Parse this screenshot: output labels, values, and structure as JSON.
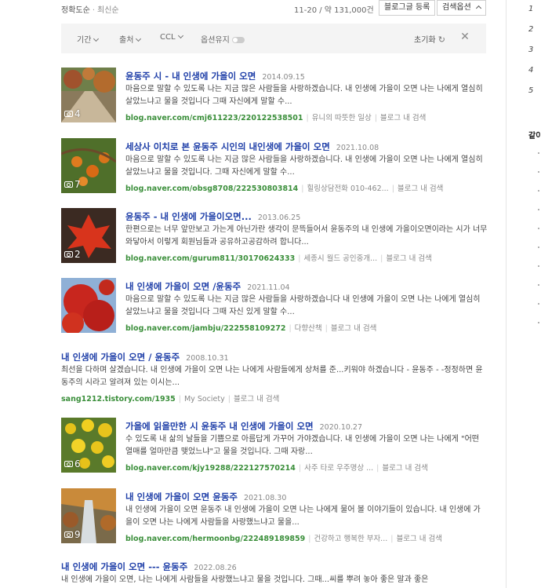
{
  "toolbar": {
    "sort_accuracy": "정확도순",
    "sort_latest": "최신순",
    "count": "11-20 / 약 131,000건",
    "register_label": "블로그글 등록",
    "options_label": "검색옵션"
  },
  "filters": {
    "period": "기간",
    "source": "출처",
    "ccl": "CCL",
    "keep_option": "옵션유지",
    "reset": "초기화"
  },
  "results": [
    {
      "title": "윤동주 시 - 내 인생에 가을이 오면",
      "date": "2014.09.15",
      "snippet": "마음으로 말할 수 있도록 나는 지금 많은 사람들을 사랑하겠습니다. 내 인생에 가을이 오면 나는 나에게 열심히 살았느냐고 물을 것입니다 그때 자신에게 말할 수...",
      "url": "blog.naver.com/cmj611223/220122538501",
      "source": "유니의 따뜻한 일상",
      "in_blog": "블로그 내 검색",
      "photo_count": "4"
    },
    {
      "title": "세상사 이치로 본 윤동주 시인의 내인생에 가을이 오면",
      "date": "2021.10.08",
      "snippet": "마음으로 말할 수 있도록 나는 지금 많은 사람들을 사랑하겠습니다. 내 인생에 가을이 오면 나는 나에게 열심히 살았느냐고 물을 것입니다. 그때 자신에게 말할 수...",
      "url": "blog.naver.com/obsg8708/222530803814",
      "source": "힐링상담전화 010-462...",
      "in_blog": "블로그 내 검색",
      "photo_count": "7"
    },
    {
      "title": "윤동주 - 내 인생에 가을이오면...",
      "date": "2013.06.25",
      "snippet": "한편으로는 너무 앞만보고 가는게 아닌가란 생각이 문뜩들어서 윤동주의 내 인생에 가을이오면이라는 시가 너무 와닿아서 이렇게 회원님들과 공유하고공감하려 합니다...",
      "url": "blog.naver.com/gurum811/30170624333",
      "source": "세종시 월드 공인중개...",
      "in_blog": "블로그 내 검색",
      "photo_count": "2"
    },
    {
      "title": "내 인생에 가을이 오면 /윤동주",
      "date": "2021.11.04",
      "snippet": "마음으로 말할 수 있도록 나는 지금 많은 사람들을 사랑하겠습니다 내 인생에 가을이 오면 나는 나에게 열심히 살았느냐고 물을 것입니다 그때 자신 있게 말할 수...",
      "url": "blog.naver.com/jambju/222558109272",
      "source": "다향산책",
      "in_blog": "블로그 내 검색",
      "photo_count": ""
    },
    {
      "title": "내 인생에 가을이 오면 / 윤동주",
      "date": "2008.10.31",
      "snippet": "최선을 다하며 살겠습니다. 내 인생에 가을이 오면 나는 나에게 사람들에게 상처를 준...키워야 하겠습니다 - 윤동주 - -정정하면 윤동주의 시라고 알려져 있는 이시는...",
      "url": "sang1212.tistory.com/1935",
      "source": "My Society",
      "in_blog": "블로그 내 검색",
      "photo_count": ""
    },
    {
      "title": "가을에 읽을만한 시 윤동주 내 인생에 가을이 오면",
      "date": "2020.10.27",
      "snippet": "수 있도록 내 삶의 날들을 기쁨으로 아름답게 가꾸어 가야겠습니다. 내 인생에 가을이 오면 나는 나에게 \"어떤 열매를 얼마만큼 맺었느냐\"고 물을 것입니다. 그때 자랑...",
      "url": "blog.naver.com/kjy19288/222127570214",
      "source": "사주 타로 우주명상 ...",
      "in_blog": "블로그 내 검색",
      "photo_count": "6"
    },
    {
      "title": "내 인생에 가을이 오면 윤동주",
      "date": "2021.08.30",
      "snippet": "내 인생에 가을이 오면 윤동주 내 인생에 가을이 오면 나는 나에게 물어 볼 이야기들이 있습니다. 내 인생에 가을이 오면 나는 나에게 사람들을 사랑했느냐고 물을...",
      "url": "blog.naver.com/hermoonbg/222489189859",
      "source": "건강하고 행복한 부자...",
      "in_blog": "블로그 내 검색",
      "photo_count": "9"
    },
    {
      "title": "내 인생에 가을이 오면 --- 윤동주",
      "date": "2022.08.26",
      "snippet": "내 인생에 가을이 오면, 나는 나에게 사람들을 사랑했느냐고 물을 것입니다. 그때...씨를 뿌려 놓아 좋은 말과 좋은",
      "url": "",
      "source": "",
      "in_blog": "",
      "photo_count": ""
    }
  ],
  "right_panel": {
    "numbers": [
      "1",
      "2",
      "3",
      "4",
      "5"
    ],
    "heading": "같이"
  },
  "colors": {
    "title_link": "#1f3fa8",
    "url_green": "#3b8f3b",
    "filter_bg": "#f4f4f4"
  }
}
